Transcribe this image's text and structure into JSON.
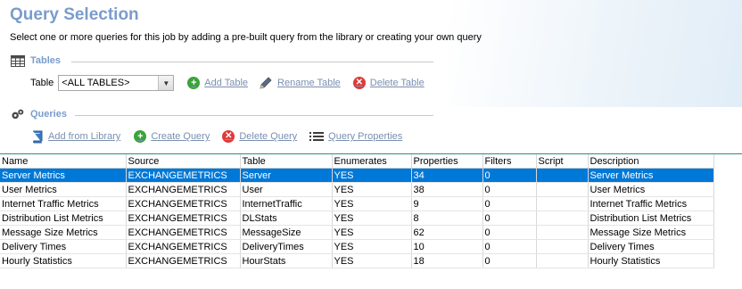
{
  "page": {
    "title": "Query Selection",
    "subtitle": "Select one or more queries for this job by adding a pre-built query from the library or creating your own query"
  },
  "tables_section": {
    "title": "Tables",
    "table_label": "Table",
    "table_selected": "<ALL TABLES>",
    "add_label": "Add Table",
    "rename_label": "Rename Table",
    "delete_label": "Delete Table"
  },
  "queries_section": {
    "title": "Queries",
    "add_library_label": "Add from Library",
    "create_label": "Create Query",
    "delete_label": "Delete Query",
    "properties_label": "Query Properties"
  },
  "grid": {
    "columns": [
      "Name",
      "Source",
      "Table",
      "Enumerates",
      "Properties",
      "Filters",
      "Script",
      "Description"
    ],
    "rows": [
      [
        "Server Metrics",
        "EXCHANGEMETRICS",
        "Server",
        "YES",
        "34",
        "0",
        "",
        "Server Metrics"
      ],
      [
        "User Metrics",
        "EXCHANGEMETRICS",
        "User",
        "YES",
        "38",
        "0",
        "",
        "User Metrics"
      ],
      [
        "Internet Traffic Metrics",
        "EXCHANGEMETRICS",
        "InternetTraffic",
        "YES",
        "9",
        "0",
        "",
        "Internet Traffic Metrics"
      ],
      [
        "Distribution List Metrics",
        "EXCHANGEMETRICS",
        "DLStats",
        "YES",
        "8",
        "0",
        "",
        "Distribution List Metrics"
      ],
      [
        "Message Size Metrics",
        "EXCHANGEMETRICS",
        "MessageSize",
        "YES",
        "62",
        "0",
        "",
        "Message Size Metrics"
      ],
      [
        "Delivery Times",
        "EXCHANGEMETRICS",
        "DeliveryTimes",
        "YES",
        "10",
        "0",
        "",
        "Delivery Times"
      ],
      [
        "Hourly Statistics",
        "EXCHANGEMETRICS",
        "HourStats",
        "YES",
        "18",
        "0",
        "",
        "Hourly Statistics"
      ]
    ],
    "selected_row": 0
  },
  "colors": {
    "accent_title": "#7a9ccc",
    "selection": "#0078d7",
    "link": "#7a8fb0"
  }
}
